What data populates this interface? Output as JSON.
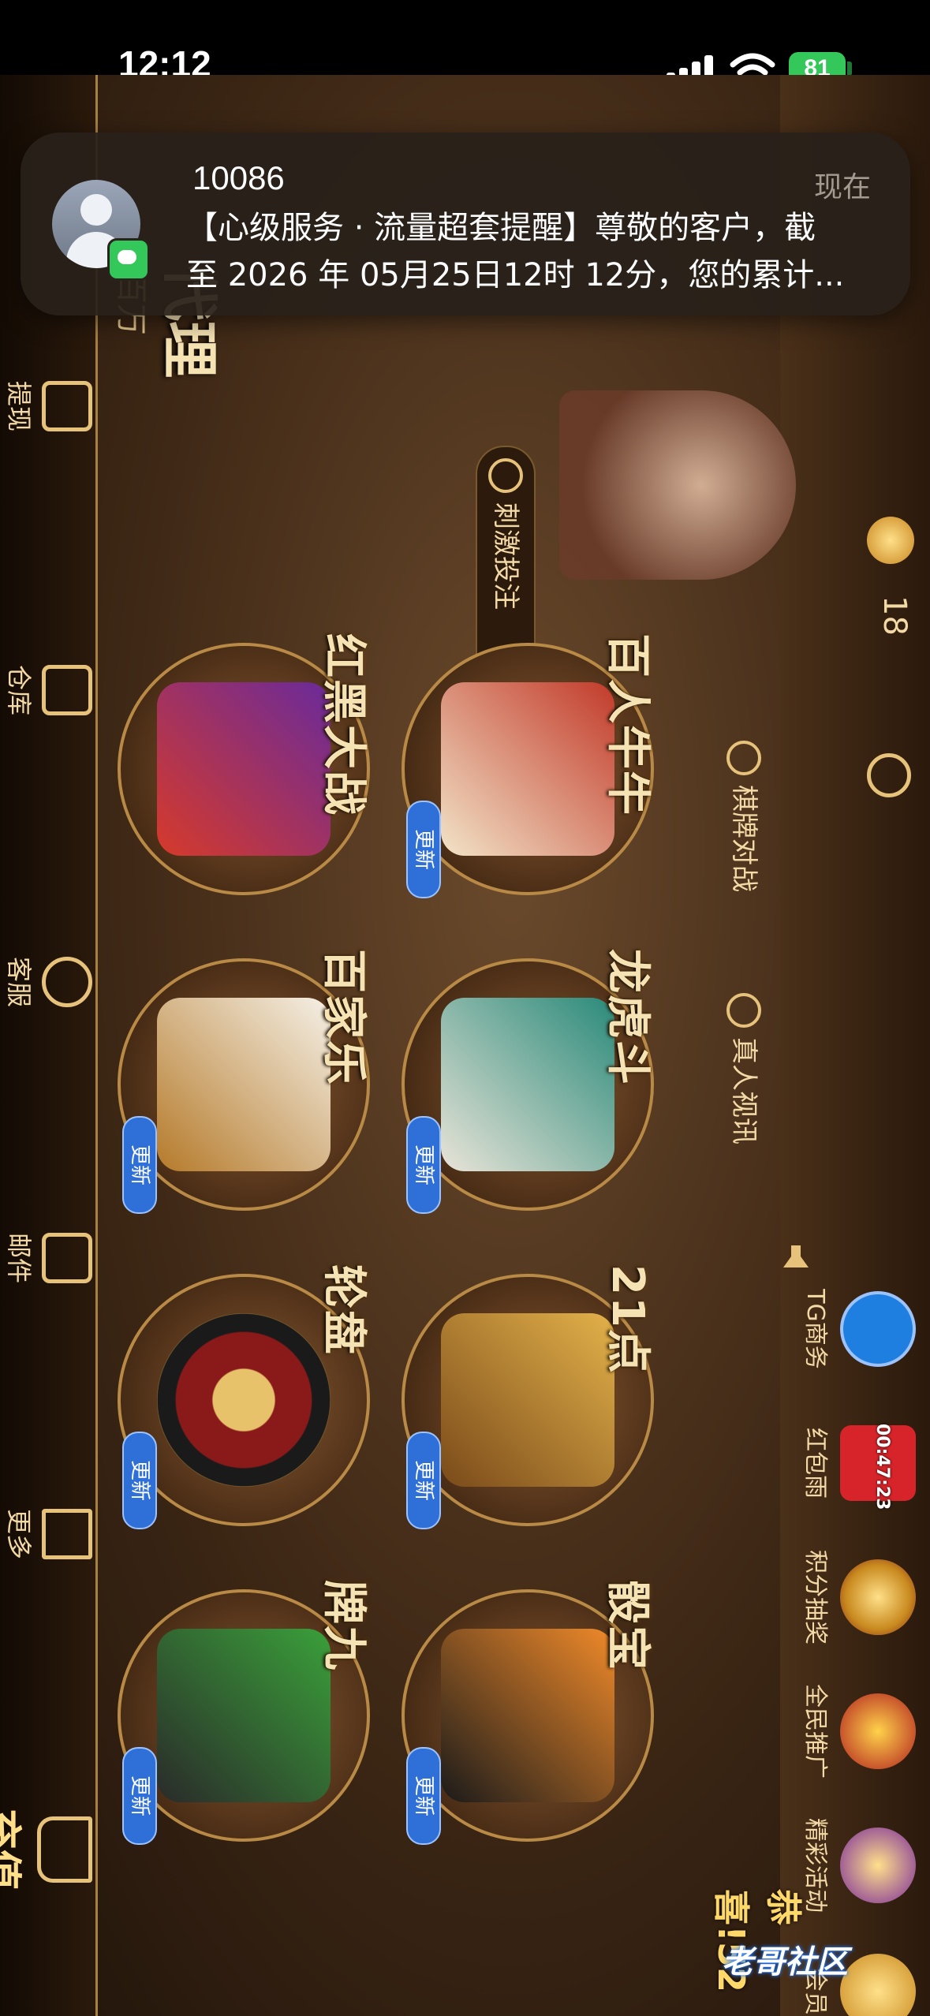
{
  "status_bar": {
    "time": "12:12",
    "battery": "81"
  },
  "notification": {
    "sender": "10086",
    "time": "现在",
    "line1": "【心级服务 · 流量超套提醒】尊敬的客户，截",
    "line2": "至 2026 年 05月25日12时 12分，您的累计..."
  },
  "top_bar": {
    "agent_label": "代理",
    "agent_sub": "百万",
    "promo_tab": "刺激投注",
    "coin_count": "18"
  },
  "categories": {
    "chess": "棋牌对战",
    "live": "真人视讯"
  },
  "games_row1": [
    {
      "name": "百人牛牛",
      "badge": "更新"
    },
    {
      "name": "龙虎斗",
      "badge": "更新"
    },
    {
      "name": "21点",
      "badge": "更新"
    },
    {
      "name": "骰宝",
      "badge": "更新"
    }
  ],
  "games_row2": [
    {
      "name": "红黑大战"
    },
    {
      "name": "百家乐",
      "badge": "更新"
    },
    {
      "name": "轮盘",
      "badge": "更新"
    },
    {
      "name": "牌九",
      "badge": "更新"
    }
  ],
  "right_buttons": [
    {
      "label": "TG商务",
      "color": "#1f7fe0"
    },
    {
      "label": "红包雨",
      "timer": "00:47:23",
      "color": "#d6242a"
    },
    {
      "label": "积分抽奖",
      "color": "#c98a1f"
    },
    {
      "label": "全民推广",
      "color": "#b01f1f"
    },
    {
      "label": "精彩活动",
      "color": "#7a2a9a"
    },
    {
      "label": "会员",
      "color": "#c98a1f"
    }
  ],
  "ticker": "恭喜!52",
  "bottom_nav": [
    {
      "label": "提现"
    },
    {
      "label": "仓库"
    },
    {
      "label": "客服"
    },
    {
      "label": "邮件"
    },
    {
      "label": "更多"
    },
    {
      "label": "充值"
    }
  ],
  "watermark": "老哥社区"
}
